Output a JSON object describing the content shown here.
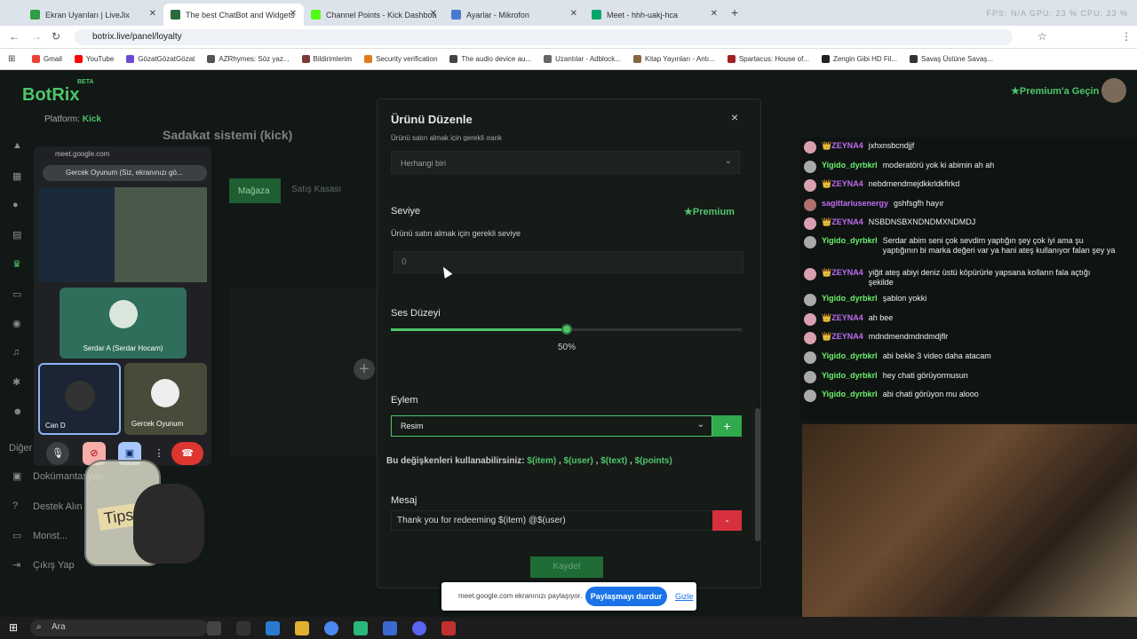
{
  "browser": {
    "tabs": [
      {
        "label": "Ekran Uyarıları | LiveJix",
        "color": "#2f9e44"
      },
      {
        "label": "The best ChatBot and Widgets",
        "color": "#2a6b3c"
      },
      {
        "label": "Channel Points - Kick Dashboa",
        "color": "#53fc18"
      },
      {
        "label": "Ayarlar - Mikrofon",
        "color": "#4a7bd0"
      },
      {
        "label": "Meet - hhh-uakj-hca",
        "color": "#00a86b"
      }
    ],
    "new_tab": "+",
    "url": "botrix.live/panel/loyalty",
    "status_text": "FPS: N/A   GPU: 23 %   CPU: 23 %",
    "bookmarks": [
      {
        "label": "Gmail",
        "color": "#ea4335"
      },
      {
        "label": "YouTube",
        "color": "#ff0000"
      },
      {
        "label": "GözatGözatGözat",
        "color": "#6a4ad0"
      },
      {
        "label": "AZRhymes: Söz yaz...",
        "color": "#555555"
      },
      {
        "label": "Bildirimlerim",
        "color": "#7a3a3a"
      },
      {
        "label": "Security verification",
        "color": "#e07a1a"
      },
      {
        "label": "The audio device au...",
        "color": "#444444"
      },
      {
        "label": "Uzantılar - Adblock...",
        "color": "#666666"
      },
      {
        "label": "Kitap Yayınları - Antı...",
        "color": "#886644"
      },
      {
        "label": "Spartacus: House of...",
        "color": "#a02020"
      },
      {
        "label": "Zengin Gibi HD Fil...",
        "color": "#222222"
      },
      {
        "label": "Savaş Üstüne Savaş...",
        "color": "#333333"
      }
    ]
  },
  "app": {
    "logo": "BotRix",
    "beta": "BETA",
    "platform_label": "Platform:",
    "platform_value": "Kick",
    "page_title": "Sadakat sistemi (kick)",
    "premium_link": "Premium'a Geçin",
    "sidebar": [
      {
        "label": "Diğer"
      },
      {
        "label": "Dokümantasyon"
      },
      {
        "label": "Destek Alın"
      },
      {
        "label": "Monst..."
      },
      {
        "label": "Çıkış Yap"
      }
    ],
    "tabs": {
      "shop": "Mağaza",
      "sales": "Satış Kasası"
    }
  },
  "meet": {
    "origin": "meet.google.com",
    "sharing_label": "Gercek Oyunum (Siz, ekranınızı gö...",
    "participants": [
      {
        "name": "Serdar A (Serdar Hocam)"
      },
      {
        "name": "Can D"
      },
      {
        "name": "Gercek Oyunum"
      }
    ],
    "tips_label": "Tips"
  },
  "modal": {
    "title": "Ürünü Düzenle",
    "close": "×",
    "cut_label": "Ürünü satın almak için gerekli ırank",
    "role_select": "Herhangi biri",
    "level_label": "Seviye",
    "premium_badge": "Premium",
    "level_hint": "Ürünü satın almak için gerekli seviye",
    "level_placeholder": "0",
    "volume_label": "Ses Düzeyi",
    "volume_percent": 50,
    "volume_text": "50%",
    "action_label": "Eylem",
    "action_value": "Resim",
    "add_button": "+",
    "vars_prefix": "Bu değişkenleri kullanabilirsiniz:",
    "vars": [
      "$(item)",
      "$(user)",
      "$(text)",
      "$(points)"
    ],
    "vars_sep": ",",
    "message_label": "Mesaj",
    "message_value": "Thank you for redeeming $(item) @$(user)",
    "remove_button": "-",
    "save_button": "Kaydet"
  },
  "share_bar": {
    "text": "meet.google.com ekranınızı paylaşıyor.",
    "stop": "Paylaşmayı durdur",
    "hide": "Gizle"
  },
  "chat": [
    {
      "user": "👑ZEYNA4",
      "color": "#c06cf0",
      "msg": "jxhxnsbcndjjf",
      "avatar": "#d9a0b0"
    },
    {
      "user": "Yigido_dyrbkrl",
      "color": "#6cf06c",
      "msg": "moderatörü yok ki abimin ah ah",
      "avatar": "#aaaaaa"
    },
    {
      "user": "👑ZEYNA4",
      "color": "#c06cf0",
      "msg": "nebdmendmejdkkrldkfirkd",
      "avatar": "#d9a0b0"
    },
    {
      "user": "sagittariusenergy",
      "color": "#c06cf0",
      "msg": "gshfsgfh hayır",
      "avatar": "#b07070"
    },
    {
      "user": "👑ZEYNA4",
      "color": "#c06cf0",
      "msg": "NSBDNSBXNDNDMXNDMDJ",
      "avatar": "#d9a0b0"
    },
    {
      "user": "Yigido_dyrbkrl",
      "color": "#6cf06c",
      "msg": "Serdar abim seni çok sevdim yaptığın şey çok iyi ama şu yaptığının bi marka değeri var ya hani ateş kullanıyor falan şey ya",
      "avatar": "#aaaaaa"
    },
    {
      "user": "👑ZEYNA4",
      "color": "#c06cf0",
      "msg": "yiğit ateş abiyi deniz üstü köpürürle yapsana kolların fala açtığı şekilde",
      "avatar": "#d9a0b0"
    },
    {
      "user": "Yigido_dyrbkrl",
      "color": "#6cf06c",
      "msg": "şablon yokki",
      "avatar": "#aaaaaa"
    },
    {
      "user": "👑ZEYNA4",
      "color": "#c06cf0",
      "msg": "ah bee",
      "avatar": "#d9a0b0"
    },
    {
      "user": "👑ZEYNA4",
      "color": "#c06cf0",
      "msg": "mdndmendmdndmdjflr",
      "avatar": "#d9a0b0"
    },
    {
      "user": "Yigido_dyrbkrl",
      "color": "#6cf06c",
      "msg": "abi bekle 3 video daha atacam",
      "avatar": "#aaaaaa"
    },
    {
      "user": "Yigido_dyrbkrl",
      "color": "#6cf06c",
      "msg": "hey chati görüyormusun",
      "avatar": "#aaaaaa"
    },
    {
      "user": "Yigido_dyrbkrl",
      "color": "#6cf06c",
      "msg": "abi chati görüyon mu alooo",
      "avatar": "#aaaaaa"
    }
  ],
  "taskbar": {
    "search_placeholder": "Ara"
  },
  "colors": {
    "accent": "#4fc56a",
    "danger": "#d9303f",
    "link": "#1a73e8"
  }
}
